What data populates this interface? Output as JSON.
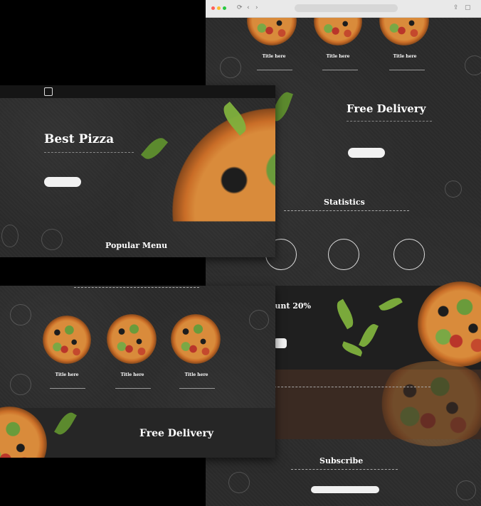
{
  "browser": {
    "url": "",
    "back_icon": "arrow-left-icon",
    "forward_icon": "arrow-right-icon",
    "refresh_icon": "refresh-icon",
    "window_controls": [
      "close",
      "minimize",
      "maximize"
    ],
    "colors": {
      "close": "#ff5f57",
      "minimize": "#ffbd2e",
      "maximize": "#28c840"
    }
  },
  "nav": {
    "logo_label": "",
    "items": [
      "",
      "",
      "",
      "",
      ""
    ]
  },
  "hero": {
    "title": "Best Pizza",
    "body": "",
    "button": ""
  },
  "popular": {
    "title": "Popular Menu",
    "intro": "",
    "items": [
      {
        "name": "Title here",
        "desc": ""
      },
      {
        "name": "Title here",
        "desc": ""
      },
      {
        "name": "Title here",
        "desc": ""
      }
    ]
  },
  "free_delivery": {
    "title": "Free Delivery",
    "body": "",
    "button": ""
  },
  "statistics": {
    "title": "Statistics",
    "body": "",
    "circles": [
      "",
      "",
      ""
    ]
  },
  "discount": {
    "title": "ount 20%",
    "body": "",
    "button": ""
  },
  "testimonial": {
    "quote": "",
    "author": ""
  },
  "subscribe": {
    "title": "Subscribe",
    "body": "",
    "input_placeholder": ""
  },
  "colors": {
    "background": "#2b2b2b",
    "accent_green": "#7fb13d",
    "accent_red": "#b9352a",
    "button": "#f2f2f2"
  }
}
